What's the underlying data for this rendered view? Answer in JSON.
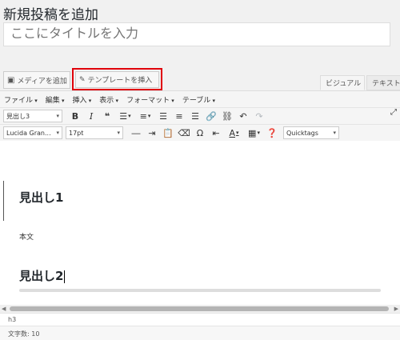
{
  "page": {
    "title": "新規投稿を追加"
  },
  "title_field": {
    "placeholder": "ここにタイトルを入力"
  },
  "buttons": {
    "add_media": "メディアを追加",
    "insert_template": "テンプレートを挿入"
  },
  "editor_tabs": {
    "visual": "ビジュアル",
    "text": "テキスト"
  },
  "menubar": [
    "ファイル",
    "編集",
    "挿入",
    "表示",
    "フォーマット",
    "テーブル"
  ],
  "toolbar": {
    "format_select": "見出し3",
    "font_family": "Lucida Gran...",
    "font_size": "17pt",
    "quicktags": "Quicktags"
  },
  "content": {
    "heading1": "見出し1",
    "body": "本文",
    "heading2": "見出し2"
  },
  "status": {
    "path": "h3",
    "word_count": "文字数: 10"
  },
  "colors": {
    "highlight_border": "#e0000b",
    "toolbar_bg": "#f5f5f5"
  }
}
